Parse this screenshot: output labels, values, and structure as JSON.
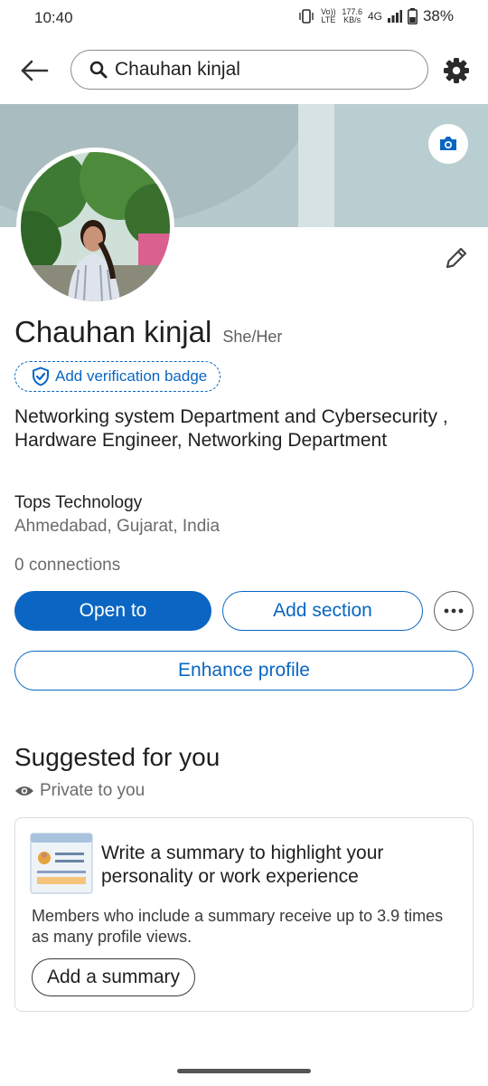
{
  "status_bar": {
    "time": "10:40",
    "net_speed_value": "177.6",
    "net_speed_unit": "KB/s",
    "network_type": "4G",
    "battery_percent": "38%",
    "volte_label": "Vo)) LTE"
  },
  "search": {
    "query": "Chauhan kinjal"
  },
  "icons": {
    "back": "back-arrow-icon",
    "search": "search-icon",
    "settings": "gear-icon",
    "camera": "camera-icon",
    "edit": "pencil-icon",
    "verify": "shield-check-icon",
    "more": "more-dots-icon",
    "private": "eye-icon"
  },
  "profile": {
    "name": "Chauhan kinjal",
    "pronouns": "She/Her",
    "verification_label": "Add verification badge",
    "headline": "Networking system Department and Cybersecurity , Hardware Engineer, Networking Department",
    "company": "Tops Technology",
    "location": "Ahmedabad, Gujarat, India",
    "connections": "0 connections"
  },
  "actions": {
    "open_to": "Open to",
    "add_section": "Add section",
    "enhance_profile": "Enhance profile"
  },
  "suggested": {
    "title": "Suggested for you",
    "privacy_label": "Private to you",
    "card": {
      "title": "Write a summary to highlight your personality or work experience",
      "description": "Members who include a summary receive up to 3.9 times as many profile views.",
      "button_label": "Add a summary"
    }
  },
  "colors": {
    "primary": "#0a66c2",
    "cover": "#b6c9cc"
  }
}
